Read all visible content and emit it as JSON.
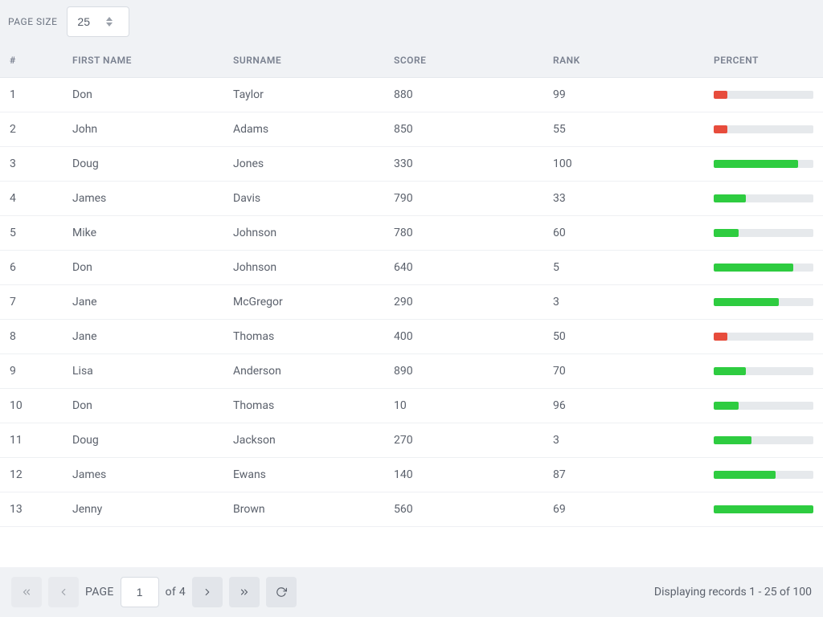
{
  "toolbar": {
    "page_size_label": "PAGE SIZE",
    "page_size_value": "25"
  },
  "columns": {
    "index": "#",
    "first_name": "FIRST NAME",
    "surname": "SURNAME",
    "score": "SCORE",
    "rank": "RANK",
    "percent": "PERCENT"
  },
  "rows": [
    {
      "index": "1",
      "first_name": "Don",
      "surname": "Taylor",
      "score": "880",
      "rank": "99",
      "percent": 14,
      "color": "red"
    },
    {
      "index": "2",
      "first_name": "John",
      "surname": "Adams",
      "score": "850",
      "rank": "55",
      "percent": 14,
      "color": "red"
    },
    {
      "index": "3",
      "first_name": "Doug",
      "surname": "Jones",
      "score": "330",
      "rank": "100",
      "percent": 85,
      "color": "green"
    },
    {
      "index": "4",
      "first_name": "James",
      "surname": "Davis",
      "score": "790",
      "rank": "33",
      "percent": 32,
      "color": "green"
    },
    {
      "index": "5",
      "first_name": "Mike",
      "surname": "Johnson",
      "score": "780",
      "rank": "60",
      "percent": 25,
      "color": "green"
    },
    {
      "index": "6",
      "first_name": "Don",
      "surname": "Johnson",
      "score": "640",
      "rank": "5",
      "percent": 80,
      "color": "green"
    },
    {
      "index": "7",
      "first_name": "Jane",
      "surname": "McGregor",
      "score": "290",
      "rank": "3",
      "percent": 65,
      "color": "green"
    },
    {
      "index": "8",
      "first_name": "Jane",
      "surname": "Thomas",
      "score": "400",
      "rank": "50",
      "percent": 14,
      "color": "red"
    },
    {
      "index": "9",
      "first_name": "Lisa",
      "surname": "Anderson",
      "score": "890",
      "rank": "70",
      "percent": 32,
      "color": "green"
    },
    {
      "index": "10",
      "first_name": "Don",
      "surname": "Thomas",
      "score": "10",
      "rank": "96",
      "percent": 25,
      "color": "green"
    },
    {
      "index": "11",
      "first_name": "Doug",
      "surname": "Jackson",
      "score": "270",
      "rank": "3",
      "percent": 38,
      "color": "green"
    },
    {
      "index": "12",
      "first_name": "James",
      "surname": "Ewans",
      "score": "140",
      "rank": "87",
      "percent": 62,
      "color": "green"
    },
    {
      "index": "13",
      "first_name": "Jenny",
      "surname": "Brown",
      "score": "560",
      "rank": "69",
      "percent": 100,
      "color": "green"
    }
  ],
  "footer": {
    "page_label": "PAGE",
    "current_page": "1",
    "of_text": "of 4",
    "records_text": "Displaying records 1 - 25 of 100"
  }
}
